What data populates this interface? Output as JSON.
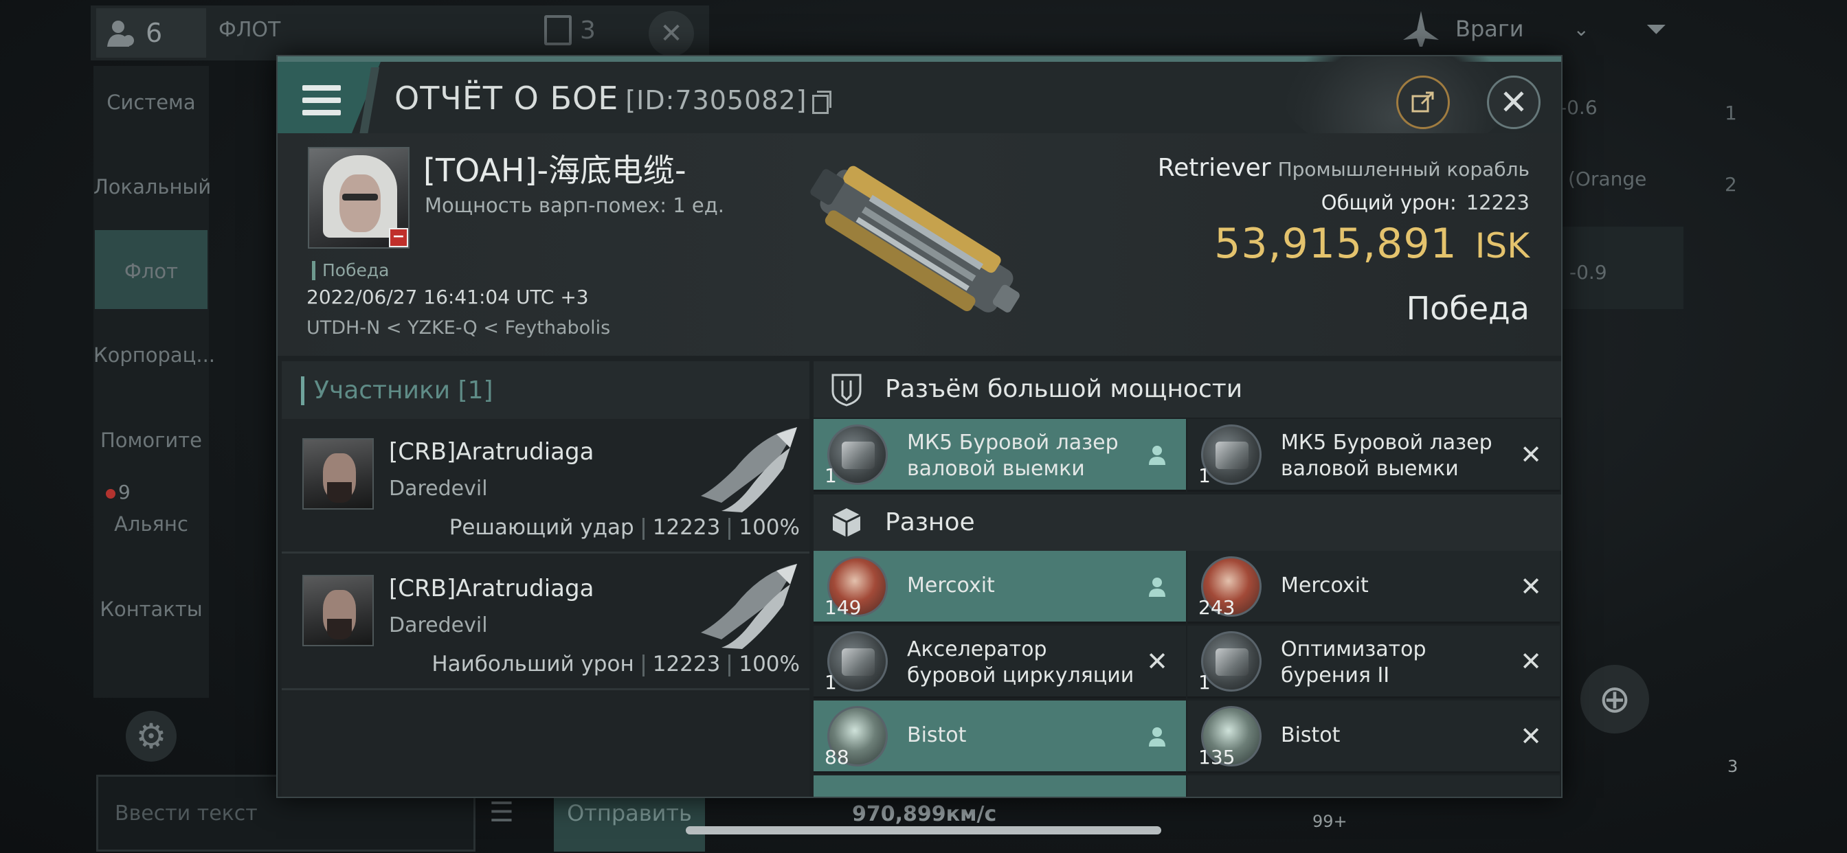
{
  "background": {
    "member_count": "6",
    "channel_label": "ФЛОТ",
    "message_count": "3",
    "sidebar_items": [
      "Система",
      "Локальный",
      "Флот",
      "Корпорац...",
      "Помогите",
      "Альянс",
      "Контакты"
    ],
    "alliance_badge": "9",
    "input_placeholder": "Ввести текст",
    "send_label": "Отправить",
    "speed": "970,899км/с",
    "enemies_label": "Враги",
    "right_values": [
      "-0.6",
      "1",
      "(Orange",
      "2",
      "-0.9"
    ],
    "notif_badge": "99+",
    "count_badge": "3"
  },
  "report": {
    "title": "ОТЧЁТ О БОЕ",
    "id": "[ID:7305082]",
    "pilot_name": "[TOAH]-海底电缆-",
    "warp_text": "Мощность варп-помех: 1 ед.",
    "victory_tag": "Победа",
    "datetime": "2022/06/27 16:41:04 UTC +3",
    "location": "UTDH-N < YZKE-Q < Feythabolis",
    "ship_name": "Retriever",
    "ship_class": "Промышленный корабль",
    "damage_label": "Общий урон:",
    "damage_value": "12223",
    "isk_value": "53,915,891",
    "isk_unit": "ISK",
    "result": "Победа"
  },
  "participants": {
    "title": "Участники [1]",
    "rows": [
      {
        "name": "[CRB]Aratrudiaga",
        "ship": "Daredevil",
        "role": "Решающий удар",
        "damage": "12223",
        "percent": "100%"
      },
      {
        "name": "[CRB]Aratrudiaga",
        "ship": "Daredevil",
        "role": "Наибольший урон",
        "damage": "12223",
        "percent": "100%"
      }
    ]
  },
  "fitting": {
    "high_title": "Разъём большой мощности",
    "misc_title": "Разное",
    "high_slots": [
      {
        "qty": "1",
        "line1": "МК5 Буровой лазер",
        "line2": "валовой выемки",
        "status": "person-icon"
      },
      {
        "qty": "1",
        "line1": "МК5 Буровой лазер",
        "line2": "валовой выемки",
        "status": "cross-icon"
      }
    ],
    "misc_slots": [
      {
        "qty": "149",
        "line1": "Mercoxit",
        "line2": "",
        "status": "person-icon"
      },
      {
        "qty": "243",
        "line1": "Mercoxit",
        "line2": "",
        "status": "cross-icon"
      },
      {
        "qty": "1",
        "line1": "Акселератор",
        "line2": "буровой циркуляции...",
        "status": "cross-icon"
      },
      {
        "qty": "1",
        "line1": "Оптимизатор",
        "line2": "бурения II",
        "status": "cross-icon"
      },
      {
        "qty": "88",
        "line1": "Bistot",
        "line2": "",
        "status": "person-icon"
      },
      {
        "qty": "135",
        "line1": "Bistot",
        "line2": "",
        "status": "cross-icon"
      }
    ]
  },
  "icons": [
    "menu-icon",
    "copy-icon",
    "share-icon",
    "close-icon",
    "person-icon",
    "cross-icon",
    "shield-slot-icon",
    "cube-icon"
  ]
}
